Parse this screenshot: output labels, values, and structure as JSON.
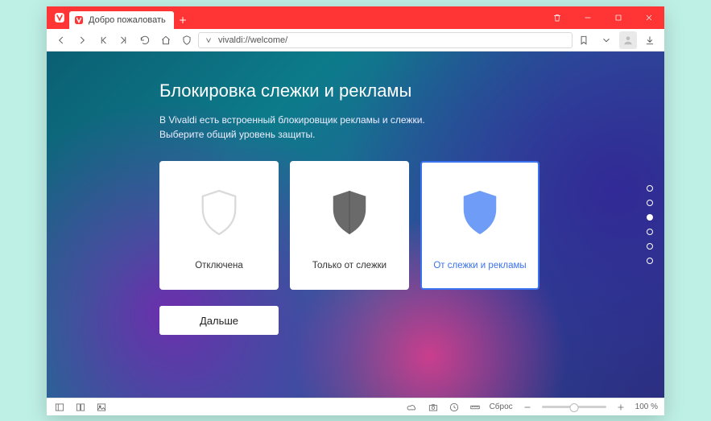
{
  "window": {
    "tab_title": "Добро пожаловать",
    "controls": {
      "trash": "trash-icon",
      "minimize": "minimize-icon",
      "maximize": "maximize-icon",
      "close": "close-icon"
    }
  },
  "addressbar": {
    "url": "vivaldi://welcome/"
  },
  "content": {
    "heading": "Блокировка слежки и рекламы",
    "lead_line1": "В Vivaldi есть встроенный блокировщик рекламы и слежки.",
    "lead_line2": "Выберите общий уровень защиты.",
    "cards": [
      {
        "label": "Отключена",
        "selected": false,
        "color": "#d9d9d9"
      },
      {
        "label": "Только от слежки",
        "selected": false,
        "color": "#6a6a6a"
      },
      {
        "label": "От слежки и рекламы",
        "selected": true,
        "color": "#6f9cf7"
      }
    ],
    "next_button": "Дальше",
    "step_count": 6,
    "step_active_index": 2
  },
  "statusbar": {
    "reset_label": "Сброс",
    "zoom_label": "100 %"
  }
}
